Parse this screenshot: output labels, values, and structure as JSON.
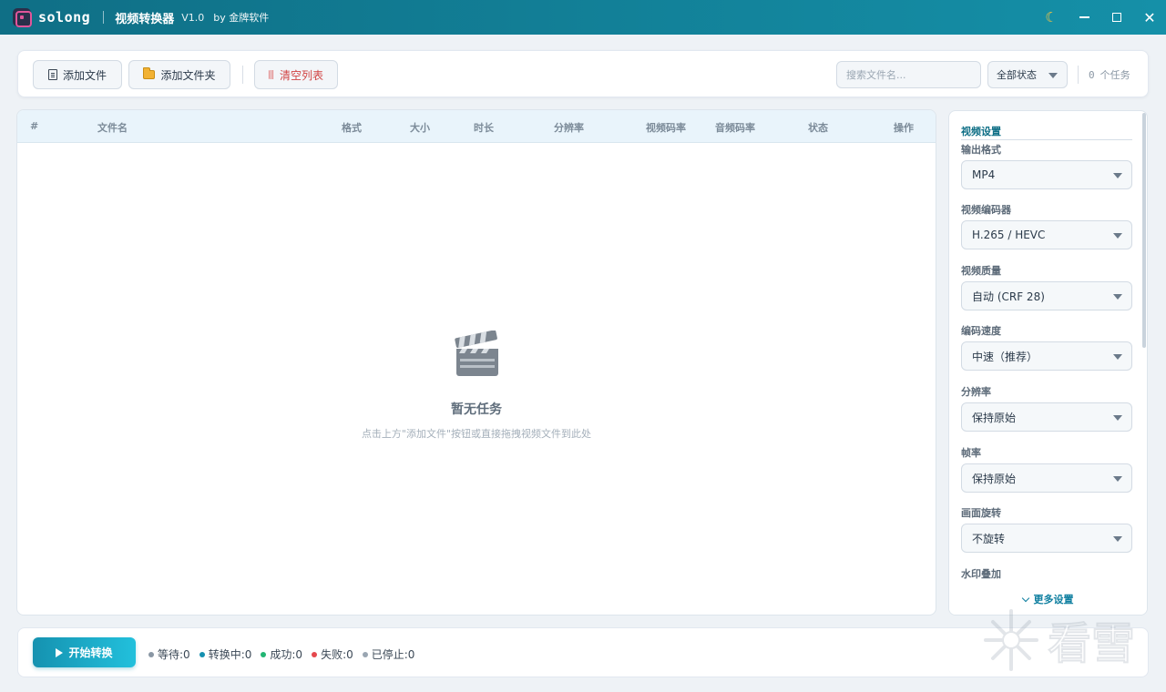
{
  "titlebar": {
    "brand": "solong",
    "app_name": "视频转换器",
    "version": "V1.0",
    "by": "by 金牌软件"
  },
  "toolbar": {
    "add_file": "添加文件",
    "add_folder": "添加文件夹",
    "clear_list": "清空列表",
    "search_placeholder": "搜索文件名...",
    "status_filter": "全部状态",
    "task_count": "0",
    "task_unit": "个任务"
  },
  "table": {
    "columns": [
      "#",
      "文件名",
      "格式",
      "大小",
      "时长",
      "分辨率",
      "视频码率",
      "音频码率",
      "状态",
      "操作"
    ],
    "rows": [],
    "empty_title": "暂无任务",
    "empty_hint": "点击上方\"添加文件\"按钮或直接拖拽视频文件到此处"
  },
  "settings": {
    "title": "视频设置",
    "fields": [
      {
        "label": "输出格式",
        "value": "MP4"
      },
      {
        "label": "视频编码器",
        "value": "H.265 / HEVC"
      },
      {
        "label": "视频质量",
        "value": "自动 (CRF 28)"
      },
      {
        "label": "编码速度",
        "value": "中速（推荐）"
      },
      {
        "label": "分辨率",
        "value": "保持原始"
      },
      {
        "label": "帧率",
        "value": "保持原始"
      },
      {
        "label": "画面旋转",
        "value": "不旋转"
      },
      {
        "label": "水印叠加",
        "value": ""
      }
    ],
    "more": "更多设置"
  },
  "bottom": {
    "start": "开始转换",
    "stats": [
      {
        "label": "等待:0",
        "color": "#8a97a4"
      },
      {
        "label": "转换中:0",
        "color": "#1590b0"
      },
      {
        "label": "成功:0",
        "color": "#22b573"
      },
      {
        "label": "失败:0",
        "color": "#e5484d"
      },
      {
        "label": "已停止:0",
        "color": "#9aa6b2"
      }
    ]
  },
  "watermark": {
    "text": "看雪"
  },
  "colors": {
    "accent": "#1590a8",
    "titlebar": "#0f6f86",
    "danger": "#d14343"
  }
}
